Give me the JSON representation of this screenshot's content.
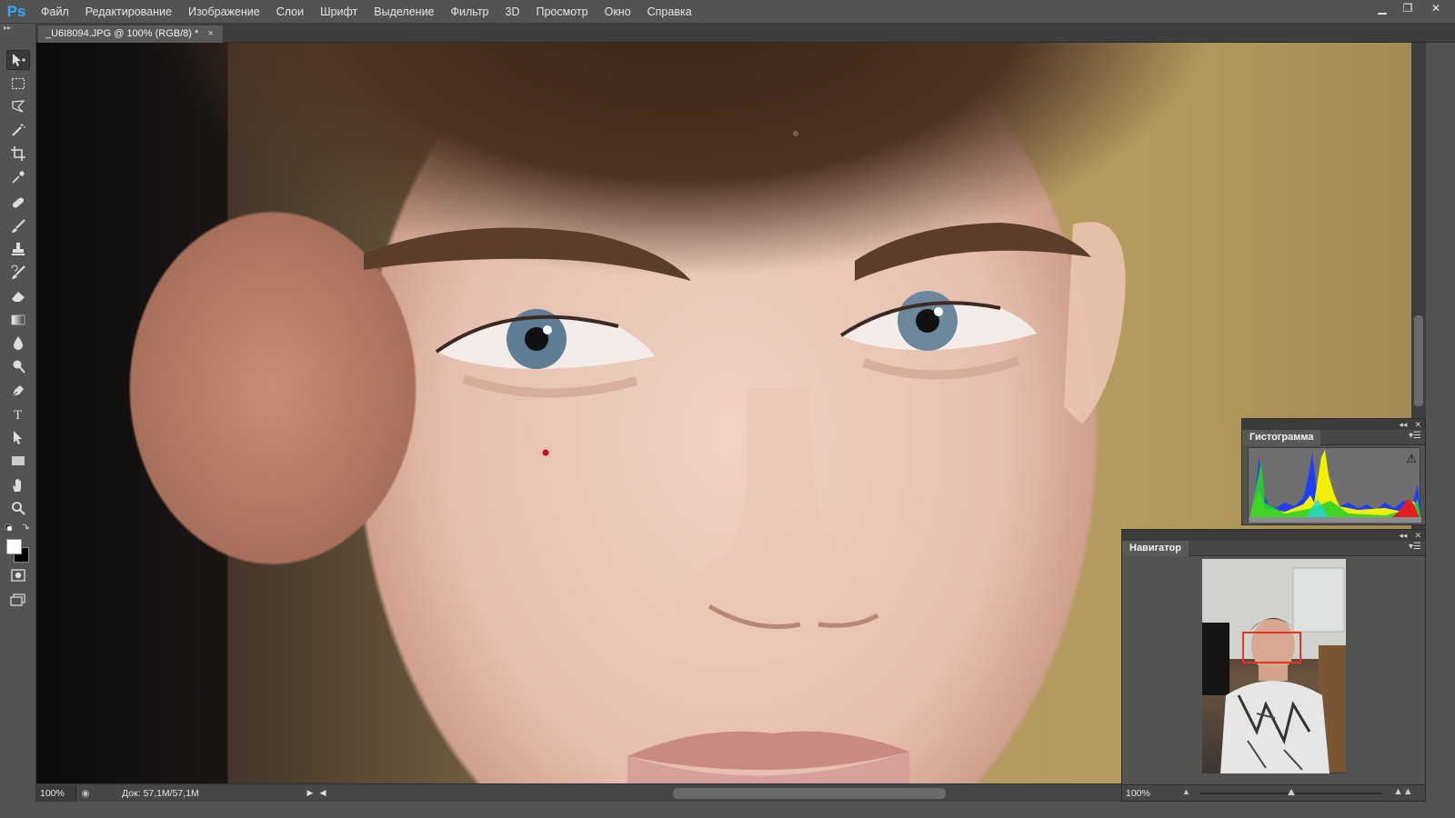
{
  "app": {
    "logo": "Ps"
  },
  "menu": [
    "Файл",
    "Редактирование",
    "Изображение",
    "Слои",
    "Шрифт",
    "Выделение",
    "Фильтр",
    "3D",
    "Просмотр",
    "Окно",
    "Справка"
  ],
  "window_controls": {
    "minimize": "▁",
    "restore": "❐",
    "close": "✕"
  },
  "document_tab": {
    "title": "_U6I8094.JPG @ 100% (RGB/8) *",
    "close": "×"
  },
  "tools": [
    "move-tool",
    "marquee-tool",
    "lasso-tool",
    "magic-wand-tool",
    "crop-tool",
    "eyedropper-tool",
    "healing-brush-tool",
    "brush-tool",
    "clone-stamp-tool",
    "history-brush-tool",
    "eraser-tool",
    "gradient-tool",
    "blur-tool",
    "dodge-tool",
    "pen-tool",
    "type-tool",
    "path-selection-tool",
    "rectangle-tool",
    "hand-tool",
    "zoom-tool"
  ],
  "colors": {
    "foreground": "#ffffff",
    "background": "#000000",
    "accent_blue": "#31a8ff",
    "nav_frame": "#e2352b"
  },
  "status": {
    "zoom": "100%",
    "doc_size": "Док: 57,1M/57,1M",
    "arrow": "▶",
    "arrow_left": "◀"
  },
  "histogram": {
    "title": "Гистограмма",
    "warning": "⚠"
  },
  "navigator": {
    "title": "Навигатор",
    "zoom": "100%",
    "zoom_level": 0.5
  },
  "panel_controls": {
    "collapse": "◂◂",
    "close": "✕",
    "menu": "▾☰"
  }
}
